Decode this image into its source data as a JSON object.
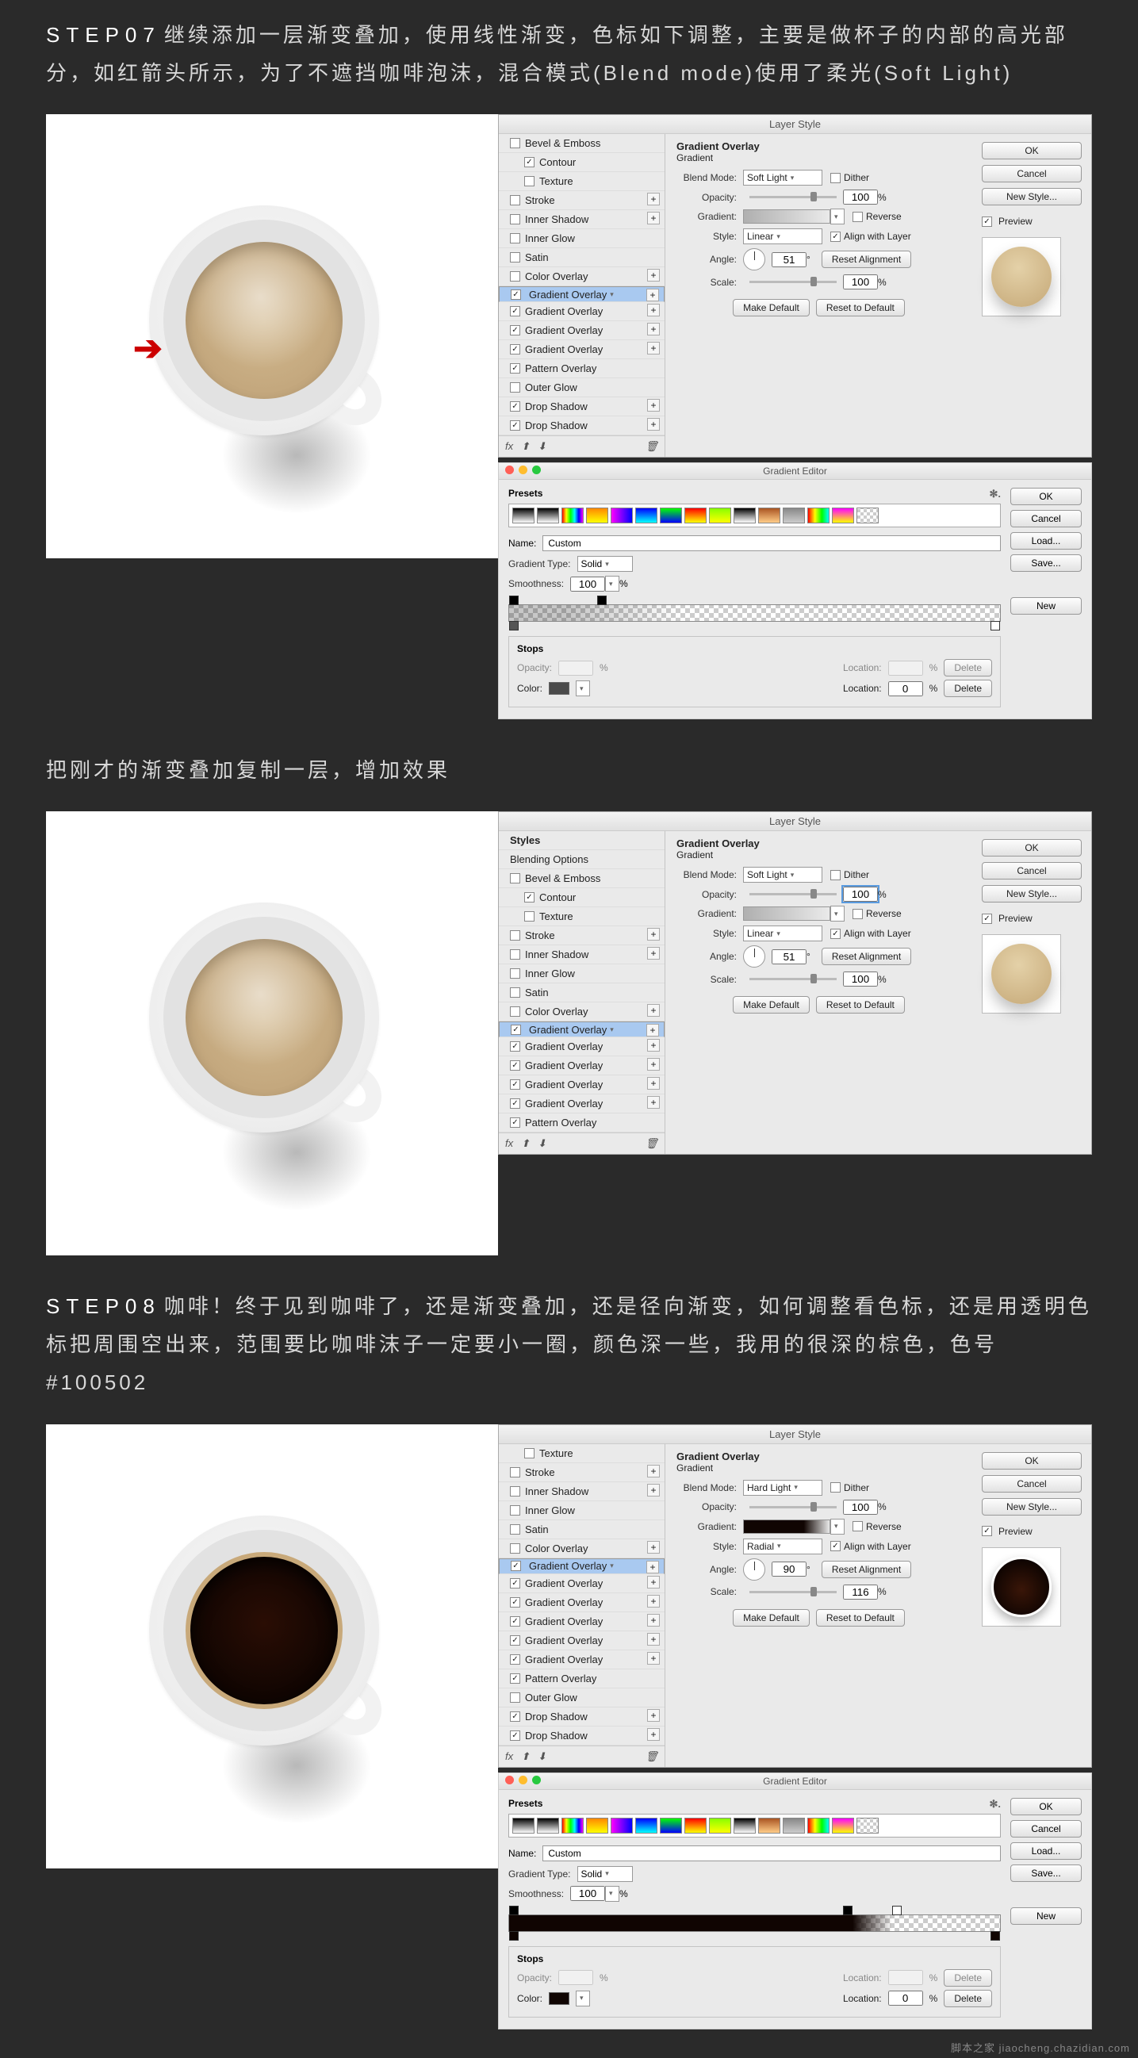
{
  "step07": {
    "label": "STEP07",
    "text": "继续添加一层渐变叠加，使用线性渐变，色标如下调整，主要是做杯子的内部的高光部分，如红箭头所示，为了不遮挡咖啡泡沫，混合模式(Blend mode)使用了柔光(Soft Light)"
  },
  "midtext": "把刚才的渐变叠加复制一层，增加效果",
  "step08": {
    "label": "STEP08",
    "text": "咖啡！终于见到咖啡了，还是渐变叠加，还是径向渐变，如何调整看色标，还是用透明色标把周围空出来，范围要比咖啡沫子一定要小一圈，颜色深一些，我用的很深的棕色，色号#100502"
  },
  "layerStyle": {
    "title": "Layer Style",
    "headingBold": "Gradient Overlay",
    "headingSub": "Gradient",
    "labels": {
      "blendMode": "Blend Mode:",
      "opacity": "Opacity:",
      "gradient": "Gradient:",
      "style": "Style:",
      "angle": "Angle:",
      "scale": "Scale:",
      "dither": "Dither",
      "reverse": "Reverse",
      "alignLayer": "Align with Layer",
      "resetAlign": "Reset Alignment",
      "percent": "%",
      "degree": "°"
    },
    "buttons": {
      "ok": "OK",
      "cancel": "Cancel",
      "newStyle": "New Style...",
      "preview": "Preview",
      "makeDefault": "Make Default",
      "resetDefault": "Reset to Default"
    }
  },
  "styleList": {
    "blendingOptions": "Blending Options",
    "stylesHdr": "Styles",
    "items": {
      "bevelEmboss": "Bevel & Emboss",
      "contour": "Contour",
      "texture": "Texture",
      "stroke": "Stroke",
      "innerShadow": "Inner Shadow",
      "innerGlow": "Inner Glow",
      "satin": "Satin",
      "colorOverlay": "Color Overlay",
      "gradientOverlay": "Gradient Overlay",
      "patternOverlay": "Pattern Overlay",
      "outerGlow": "Outer Glow",
      "dropShadow": "Drop Shadow"
    },
    "fx": "fx"
  },
  "dlgA": {
    "blendMode": "Soft Light",
    "opacity": "100",
    "style": "Linear",
    "angle": "51",
    "scale": "100"
  },
  "dlgB": {
    "blendMode": "Soft Light",
    "opacity": "100",
    "style": "Linear",
    "angle": "51",
    "scale": "100"
  },
  "dlgC": {
    "blendMode": "Hard Light",
    "opacity": "100",
    "style": "Radial",
    "angle": "90",
    "scale": "116"
  },
  "gradEditor": {
    "title": "Gradient Editor",
    "presets": "Presets",
    "name": "Name:",
    "nameValue": "Custom",
    "gradientType": "Gradient Type:",
    "gradientTypeVal": "Solid",
    "smoothness": "Smoothness:",
    "smoothnessVal": "100",
    "stops": "Stops",
    "opacityLbl": "Opacity:",
    "locationLbl": "Location:",
    "colorLbl": "Color:",
    "locationVal": "0",
    "buttons": {
      "ok": "OK",
      "cancel": "Cancel",
      "load": "Load...",
      "save": "Save...",
      "new": "New",
      "delete": "Delete"
    }
  },
  "watermark": "脚本之家 jiaocheng.chazidian.com"
}
